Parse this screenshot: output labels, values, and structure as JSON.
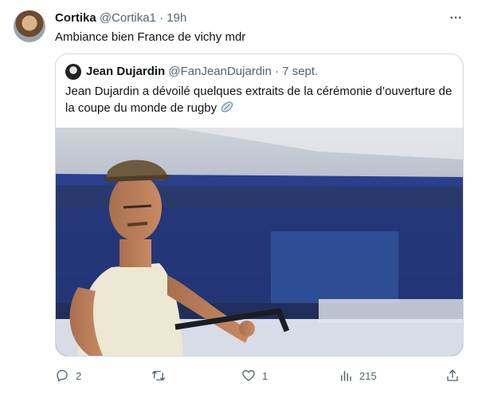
{
  "tweet": {
    "author_name": "Cortika",
    "author_handle": "@Cortika1",
    "separator": "·",
    "time": "19h",
    "text": "Ambiance bien France de vichy mdr"
  },
  "quoted": {
    "author_name": "Jean Dujardin",
    "author_handle": "@FanJeanDujardin",
    "separator": "·",
    "time": "7 sept.",
    "text": "Jean Dujardin a dévoilé quelques extraits de la cérémonie d’ouverture de la coupe du monde de rugby"
  },
  "actions": {
    "replies": "2",
    "retweets": "",
    "likes": "1",
    "views": "215"
  },
  "icons": {
    "more": "more-icon",
    "reply": "reply-icon",
    "retweet": "retweet-icon",
    "like": "like-icon",
    "views": "views-icon",
    "share": "share-icon",
    "rugby": "rugby-ball-icon"
  },
  "colors": {
    "text": "#0f1419",
    "muted": "#536471",
    "border": "#cfd9de"
  }
}
